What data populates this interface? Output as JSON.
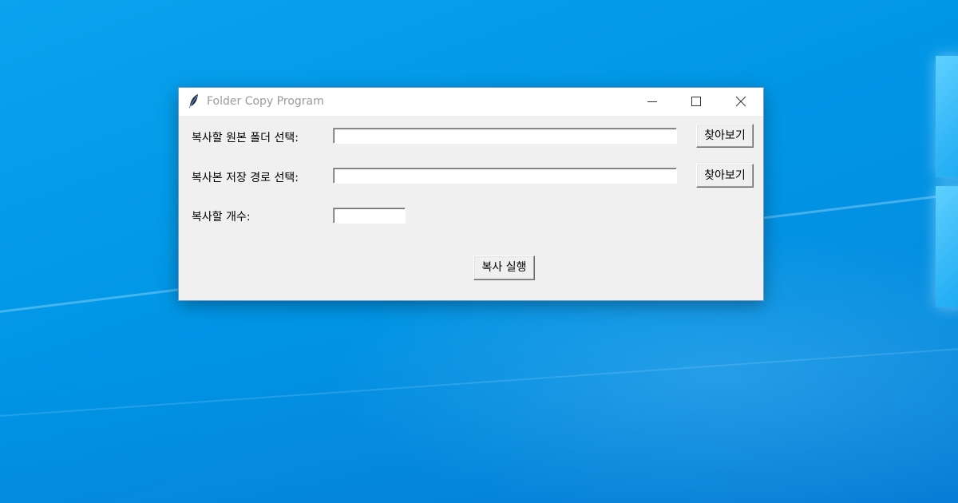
{
  "window": {
    "title": "Folder Copy Program",
    "app_icon": "tk-feather-icon",
    "controls": [
      "minimize-icon",
      "maximize-icon",
      "close-icon"
    ]
  },
  "form": {
    "source_label": "복사할 원본 폴더 선택:",
    "source_value": "",
    "source_browse_label": "찾아보기",
    "dest_label": "복사본 저장 경로 선택:",
    "dest_value": "",
    "dest_browse_label": "찾아보기",
    "count_label": "복사할 개수:",
    "count_value": "",
    "run_label": "복사 실행"
  },
  "colors": {
    "desktop": "#0096e6",
    "window_bg": "#f0f0f0",
    "titlebar_bg": "#ffffff",
    "title_text": "#9a9a9a"
  }
}
